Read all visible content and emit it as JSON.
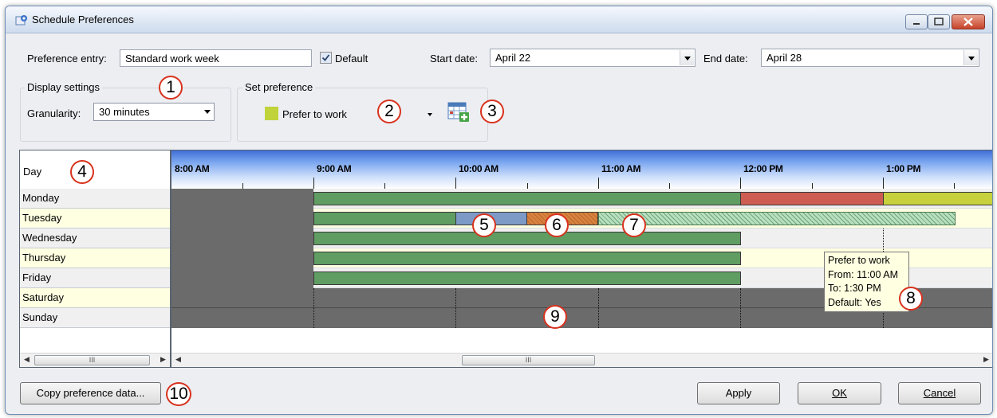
{
  "window": {
    "title": "Schedule Preferences",
    "colors": {
      "title_bar": "#dce6f3",
      "close": "#c7432a"
    }
  },
  "top": {
    "preference_entry_label": "Preference entry:",
    "preference_entry_value": "Standard work week",
    "default_checked": true,
    "default_label": "Default",
    "start_date_label": "Start date:",
    "start_date_value": "April 22",
    "end_date_label": "End date:",
    "end_date_value": "April 28"
  },
  "display_settings": {
    "title": "Display settings",
    "granularity_label": "Granularity:",
    "granularity_value": "30 minutes"
  },
  "set_preference": {
    "title": "Set preference",
    "preference_value": "Prefer to work",
    "swatch_color": "#c1d33b",
    "icon": "calendar-add-icon"
  },
  "callouts": [
    "1",
    "2",
    "3",
    "4",
    "5",
    "6",
    "7",
    "8",
    "9",
    "10"
  ],
  "grid": {
    "day_header": "Day",
    "days": [
      "Monday",
      "Tuesday",
      "Wednesday",
      "Thursday",
      "Friday",
      "Saturday",
      "Sunday"
    ],
    "times": [
      "8:00 AM",
      "9:00 AM",
      "10:00 AM",
      "11:00 AM",
      "12:00 PM",
      "1:00 PM"
    ],
    "colors": {
      "prefer_work": "#5f9d63",
      "unavailable": "#6b6b6b",
      "red": "#cd5d52",
      "yellow": "#c6d13d",
      "blue": "#7d9ac7",
      "orange": "#d9823f",
      "hatch": "#9ad0a6"
    }
  },
  "tooltip": {
    "line1": "Prefer to work",
    "line2": "From: 11:00 AM",
    "line3": "To: 1:30 PM",
    "line4": "Default: Yes"
  },
  "scrollbar": {
    "thumb_grip": "III"
  },
  "buttons": {
    "copy": "Copy preference data...",
    "apply": "Apply",
    "ok": "OK",
    "cancel": "Cancel"
  }
}
